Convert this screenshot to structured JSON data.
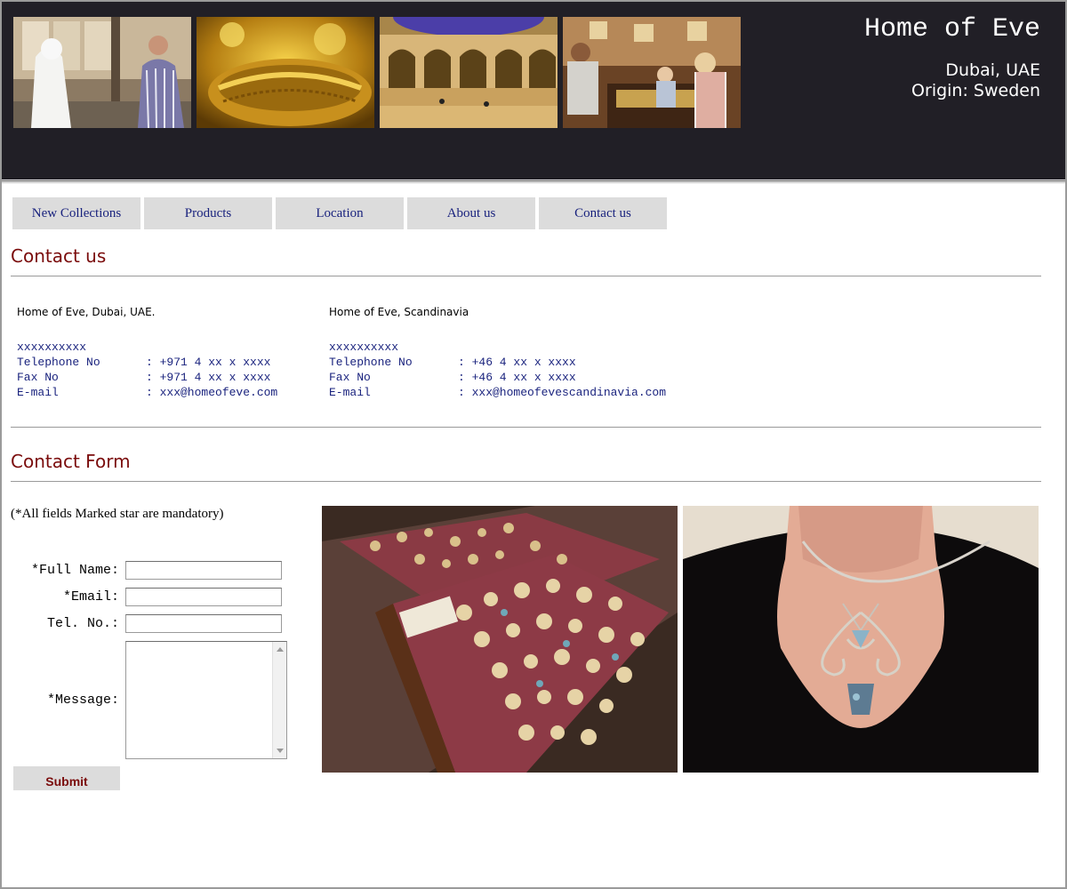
{
  "header": {
    "title": "Home of Eve",
    "location": "Dubai, UAE",
    "origin": "Origin: Sweden",
    "photos": [
      "jewellery-shop-photo",
      "gold-bracelet-photo",
      "mall-interior-photo",
      "jewellery-counter-photo"
    ]
  },
  "nav": {
    "items": [
      "New Collections",
      "Products",
      "Location",
      "About us",
      "Contact us"
    ]
  },
  "contact": {
    "heading": "Contact us",
    "offices": [
      {
        "title": "Home of Eve, Dubai, UAE.",
        "rows": [
          {
            "label": "xxxxxxxxxx",
            "value": ""
          },
          {
            "label": "Telephone No",
            "value": ": +971 4 xx x xxxx"
          },
          {
            "label": "Fax No",
            "value": ": +971 4 xx x xxxx"
          },
          {
            "label": "E-mail",
            "value": ": xxx@homeofeve.com"
          }
        ]
      },
      {
        "title": "Home of Eve, Scandinavia",
        "rows": [
          {
            "label": "xxxxxxxxxx",
            "value": ""
          },
          {
            "label": "Telephone No",
            "value": ": +46 4 xx x xxxx"
          },
          {
            "label": "Fax No",
            "value": ": +46 4 xx x xxxx"
          },
          {
            "label": "E-mail",
            "value": ": xxx@homeofevescandinavia.com"
          }
        ]
      }
    ]
  },
  "form": {
    "heading": "Contact Form",
    "mandatory_note": "(*All fields Marked star are mandatory)",
    "full_name_label": "*Full Name:",
    "email_label": "*Email:",
    "tel_label": "Tel. No.:",
    "message_label": "*Message:",
    "full_name_value": "",
    "email_value": "",
    "tel_value": "",
    "message_value": "",
    "submit_label": "Submit"
  },
  "photos": {
    "left": "earrings-tray-photo",
    "right": "necklace-pendant-photo"
  },
  "colors": {
    "header_bg": "#211f26",
    "accent": "#7a0b0b",
    "nav_bg": "#dcdcdc",
    "nav_text": "#1a237e"
  }
}
